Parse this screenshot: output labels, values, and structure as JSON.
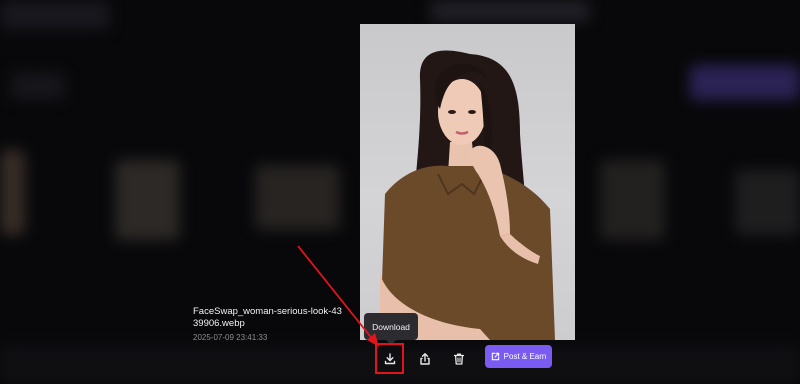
{
  "preview": {
    "file_name": "FaceSwap_woman-serious-look-4339906.webp",
    "date": "2025-07-09 23:41:33",
    "image_description": "woman-in-brown-dress-portrait"
  },
  "tooltip": {
    "label": "Download"
  },
  "toolbar": {
    "download_icon": "download-icon",
    "share_icon": "share-icon",
    "delete_icon": "trash-icon",
    "post_earn_icon": "external-link-icon",
    "post_earn_label": "Post & Earn"
  },
  "colors": {
    "accent": "#7b5cf2",
    "highlight": "#e0141a",
    "background": "#0b0b0e"
  }
}
